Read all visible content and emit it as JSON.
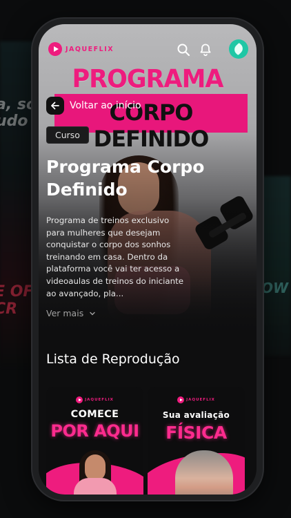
{
  "app": {
    "brand": "JAQUEFLIX",
    "colors": {
      "accent": "#ee1c7e",
      "avatar": "#1fc7a5",
      "background": "#0e0e0f"
    }
  },
  "header": {
    "icons": [
      "search-icon",
      "bell-icon"
    ],
    "avatar_icon": "leaf-icon"
  },
  "hero": {
    "image_title_line1": "PROGRAMA",
    "image_title_line2": "CORPO DEFINIDO"
  },
  "back": {
    "label": "Voltar ao início"
  },
  "course": {
    "badge": "Curso",
    "title": "Programa Corpo Definido",
    "description": "Programa de treinos exclusivo para mulheres que desejam conquistar o corpo dos sonhos treinando em casa. Dentro da plataforma você vai ter acesso a videoaulas de treinos do iniciante ao avançado, pla...",
    "see_more": "Ver mais"
  },
  "playlist": {
    "title": "Lista de Reprodução",
    "items": [
      {
        "brand": "JAQUEFLIX",
        "line1": "COMECE",
        "line2": "POR AQUI"
      },
      {
        "brand": "JAQUEFLIX",
        "line1": "Sua avaliação",
        "line2": "FÍSICA"
      }
    ]
  },
  "background": {
    "left_text": "a, so\nudo co",
    "left_bottom_text": "E OF\nCR",
    "right_text": "OW"
  }
}
